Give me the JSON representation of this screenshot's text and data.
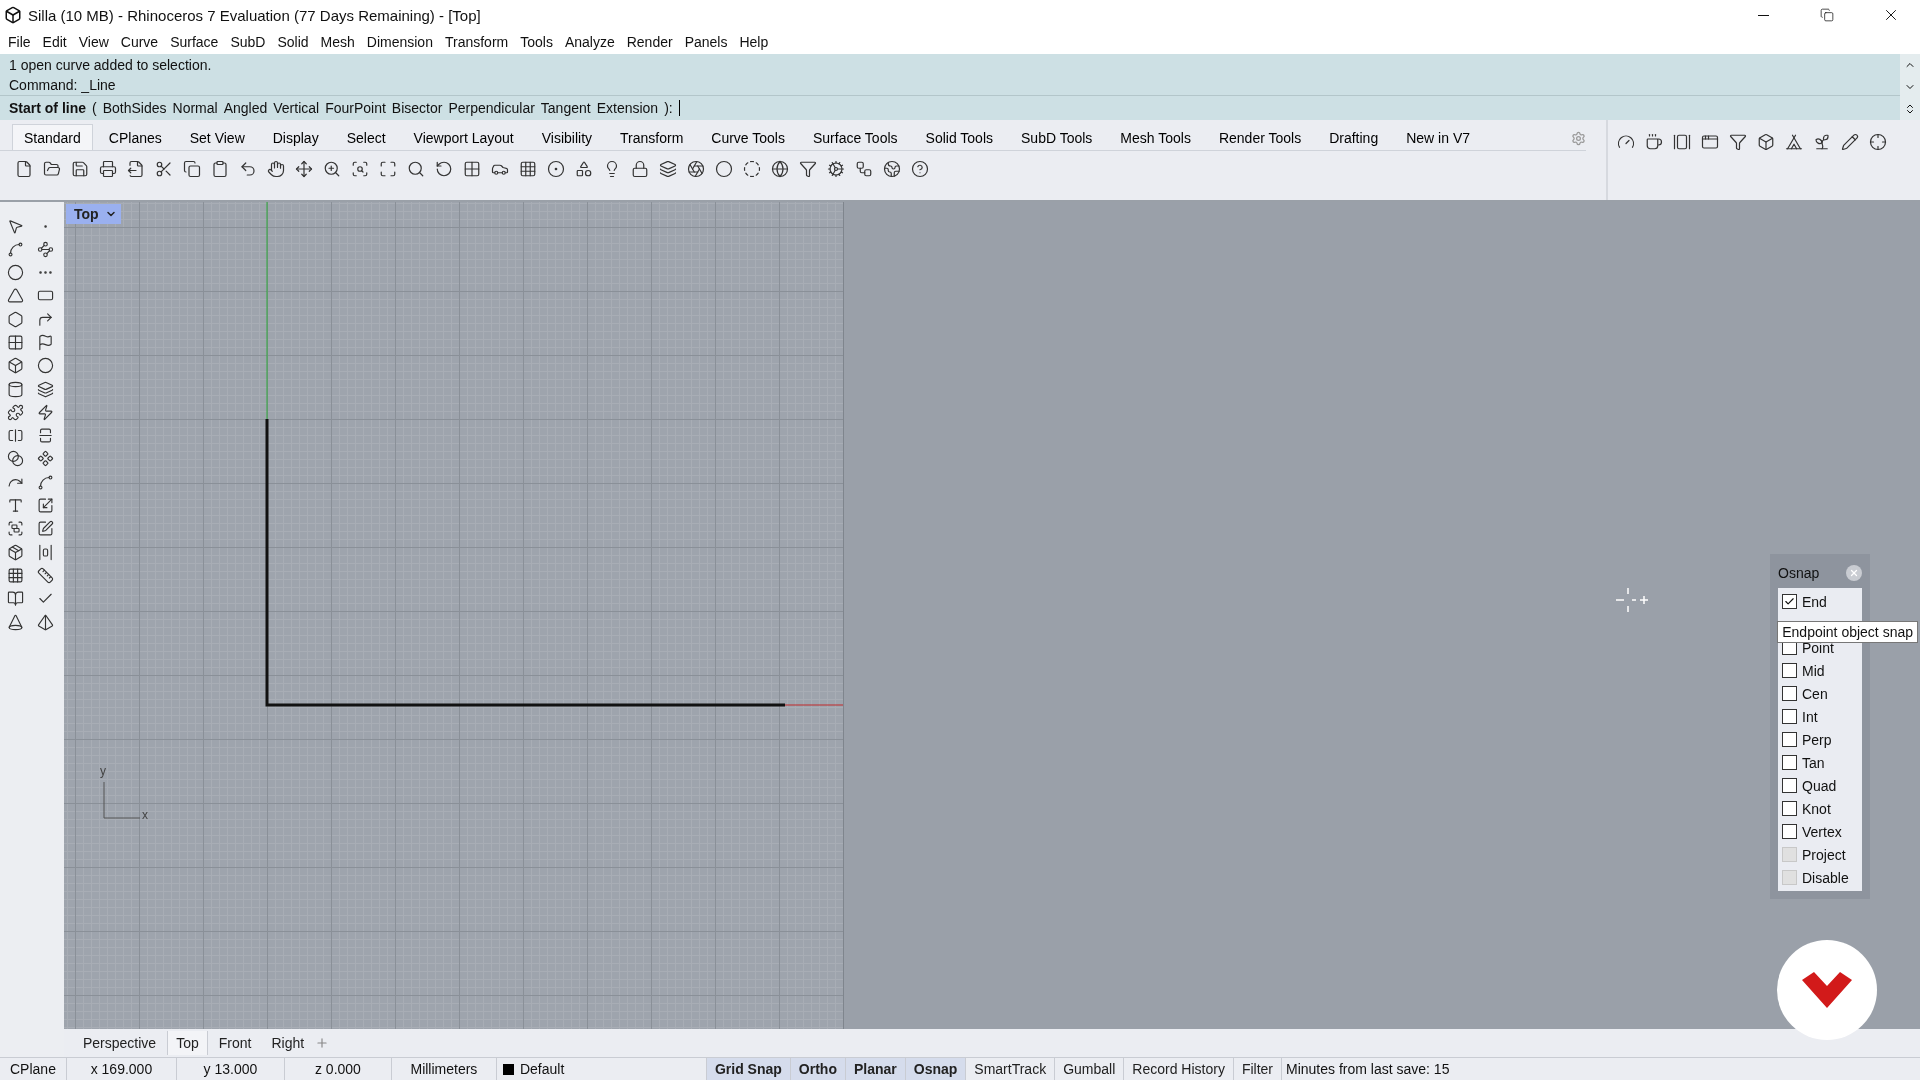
{
  "window": {
    "title": "Silla (10 MB) - Rhinoceros 7 Evaluation (77 Days Remaining) - [Top]"
  },
  "menu": [
    "File",
    "Edit",
    "View",
    "Curve",
    "Surface",
    "SubD",
    "Solid",
    "Mesh",
    "Dimension",
    "Transform",
    "Tools",
    "Analyze",
    "Render",
    "Panels",
    "Help"
  ],
  "command": {
    "history": [
      "1 open curve added to selection.",
      "Command: _Line"
    ],
    "prompt": "Start of line",
    "open": "(",
    "options": [
      "BothSides",
      "Normal",
      "Angled",
      "Vertical",
      "FourPoint",
      "Bisector",
      "Perpendicular",
      "Tangent",
      "Extension"
    ],
    "close": "):"
  },
  "toolbar_tabs": [
    {
      "label": "Standard",
      "selected": true
    },
    {
      "label": "CPlanes",
      "selected": false
    },
    {
      "label": "Set View",
      "selected": false
    },
    {
      "label": "Display",
      "selected": false
    },
    {
      "label": "Select",
      "selected": false
    },
    {
      "label": "Viewport Layout",
      "selected": false
    },
    {
      "label": "Visibility",
      "selected": false
    },
    {
      "label": "Transform",
      "selected": false
    },
    {
      "label": "Curve Tools",
      "selected": false
    },
    {
      "label": "Surface Tools",
      "selected": false
    },
    {
      "label": "Solid Tools",
      "selected": false
    },
    {
      "label": "SubD Tools",
      "selected": false
    },
    {
      "label": "Mesh Tools",
      "selected": false
    },
    {
      "label": "Render Tools",
      "selected": false
    },
    {
      "label": "Drafting",
      "selected": false
    },
    {
      "label": "New in V7",
      "selected": false
    }
  ],
  "viewport": {
    "title": "Top",
    "axis_labels": [
      "y",
      "x"
    ]
  },
  "osnap": {
    "title": "Osnap",
    "tooltip": "Endpoint object snap",
    "items": [
      {
        "label": "End",
        "checked": true,
        "disabled": false
      },
      {
        "kind": "hidden"
      },
      {
        "label": "Point",
        "checked": false,
        "disabled": false
      },
      {
        "label": "Mid",
        "checked": false,
        "disabled": false
      },
      {
        "label": "Cen",
        "checked": false,
        "disabled": false
      },
      {
        "label": "Int",
        "checked": false,
        "disabled": false
      },
      {
        "label": "Perp",
        "checked": false,
        "disabled": false
      },
      {
        "label": "Tan",
        "checked": false,
        "disabled": false
      },
      {
        "label": "Quad",
        "checked": false,
        "disabled": false
      },
      {
        "label": "Knot",
        "checked": false,
        "disabled": false
      },
      {
        "label": "Vertex",
        "checked": false,
        "disabled": false
      },
      {
        "label": "Project",
        "checked": false,
        "disabled": true
      },
      {
        "label": "Disable",
        "checked": false,
        "disabled": true
      }
    ]
  },
  "viewport_tabs": [
    {
      "label": "Perspective",
      "selected": false
    },
    {
      "label": "Top",
      "selected": true
    },
    {
      "label": "Front",
      "selected": false
    },
    {
      "label": "Right",
      "selected": false
    }
  ],
  "status_bar": {
    "cells": [
      "CPlane",
      "x 169.000",
      "y 13.000",
      "z 0.000",
      "Millimeters"
    ],
    "layer": "Default",
    "toggles": [
      {
        "label": "Grid Snap",
        "on": true
      },
      {
        "label": "Ortho",
        "on": true
      },
      {
        "label": "Planar",
        "on": true
      },
      {
        "label": "Osnap",
        "on": true
      },
      {
        "label": "SmartTrack",
        "on": false
      },
      {
        "label": "Gumball",
        "on": false
      },
      {
        "label": "Record History",
        "on": false
      },
      {
        "label": "Filter",
        "on": false
      }
    ],
    "message": "Minutes from last save: 15"
  }
}
